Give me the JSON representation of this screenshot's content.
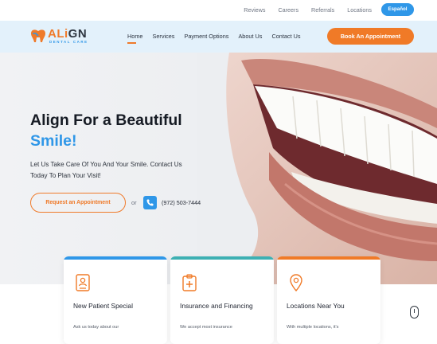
{
  "topbar": {
    "links": [
      "Reviews",
      "Careers",
      "Referrals",
      "Locations"
    ],
    "language_button": "Español"
  },
  "brand": {
    "name_part1": "ALi",
    "name_part2": "GN",
    "tagline": "DENTAL CARE"
  },
  "nav": {
    "items": [
      "Home",
      "Services",
      "Payment Options",
      "About Us",
      "Contact Us"
    ],
    "active": "Home",
    "cta": "Book An Appointment"
  },
  "hero": {
    "headline": "Align For a Beautiful",
    "headline_accent": "Smile!",
    "lead": "Let Us Take Care Of You And Your Smile. Contact Us Today To Plan Your Visit!",
    "request_button": "Request an Appointment",
    "or_text": "or",
    "phone": "(972) 503-7444"
  },
  "cards": [
    {
      "title": "New Patient Special",
      "desc": "Ask us today about our",
      "icon": "id-card-icon",
      "accent": "#2f97e8"
    },
    {
      "title": "Insurance and Financing",
      "desc": "We accept most insurance",
      "icon": "medical-clipboard-icon",
      "accent": "#3db0b3"
    },
    {
      "title": "Locations Near You",
      "desc": "With multiple locations, it's",
      "icon": "location-pin-icon",
      "accent": "#f07a27"
    }
  ],
  "colors": {
    "brand_orange": "#f07a27",
    "brand_blue": "#2f97e8",
    "teal": "#3db0b3",
    "nav_bg": "#e3f1fb"
  }
}
